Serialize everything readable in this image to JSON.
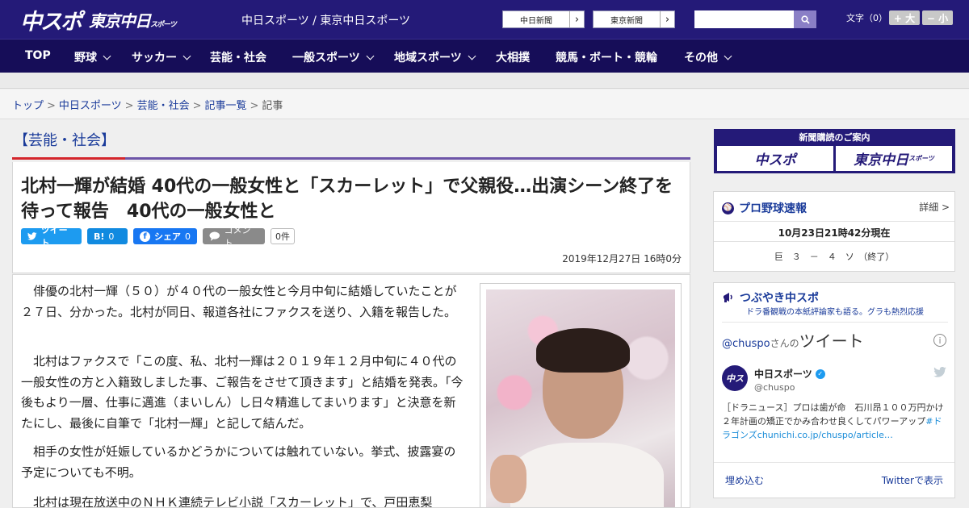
{
  "header": {
    "logo_main": "中スポ",
    "logo_sub": "東京中日",
    "logo_sub_small": "スポーツ",
    "site_title": "中日スポーツ / 東京中日スポーツ",
    "link1": "中日新聞",
    "link2": "東京新聞",
    "font_label": "文字（0）",
    "font_plus": "+ 大",
    "font_minus": "− 小"
  },
  "nav": [
    {
      "label": "TOP",
      "dropdown": false
    },
    {
      "label": "野球",
      "dropdown": true
    },
    {
      "label": "サッカー",
      "dropdown": true
    },
    {
      "label": "芸能・社会",
      "dropdown": false
    },
    {
      "label": "一般スポーツ",
      "dropdown": true
    },
    {
      "label": "地域スポーツ",
      "dropdown": true
    },
    {
      "label": "大相撲",
      "dropdown": false
    },
    {
      "label": "競馬・ボート・競輪",
      "dropdown": false
    },
    {
      "label": "その他",
      "dropdown": true
    }
  ],
  "breadcrumb": {
    "c1": "トップ",
    "c2": "中日スポーツ",
    "c3": "芸能・社会",
    "c4": "記事一覧",
    "c5": "記事",
    "sep": ">"
  },
  "category": "【芸能・社会】",
  "article": {
    "headline": "北村一輝が結婚 40代の一般女性と「スカーレット」で父親役…出演シーン終了を待って報告　40代の一般女性と",
    "tweet": "ツイート",
    "hatena": "B!",
    "hatena_count": "0",
    "share": "シェア",
    "share_count": "0",
    "comment": "コメント",
    "comment_count": "0件",
    "date": "2019年12月27日 16時0分",
    "paragraphs": [
      "俳優の北村一輝（５０）が４０代の一般女性と今月中旬に結婚していたことが２７日、分かった。北村が同日、報道各社にファクスを送り、入籍を報告した。",
      "北村はファクスで「この度、私、北村一輝は２０１９年１２月中旬に４０代の一般女性の方と入籍致しました事、ご報告をさせて頂きます」と結婚を発表。「今後もより一層、仕事に邁進（まいしん）し日々精進してまいります」と決意を新たにし、最後に自筆で「北村一輝」と記して結んだ。",
      "相手の女性が妊娠しているかどうかについては触れていない。挙式、披露宴の予定についても不明。",
      "北村は現在放送中のＮＨＫ連続テレビ小説「スカーレット」で、戸田恵梨"
    ]
  },
  "sidebar": {
    "subscribe_title": "新聞購読のご案内",
    "sub_btn1": "中スポ",
    "sub_btn2": "東京中日",
    "sub_btn2_small": "スポーツ",
    "baseball_title": "プロ野球速報",
    "baseball_more": "詳細 >",
    "baseball_time": "10月23日21時42分現在",
    "baseball_score": "巨　３　－　４　ソ　（終了）",
    "tsubuyaki_title": "つぶやき中スポ",
    "tsubuyaki_sub": "ドラ番観戦の本紙評論家も語る。グラも熱烈応援",
    "tweets_handle": "@chuspo",
    "tweets_san": "さんの",
    "tweets_word": "ツイート",
    "tw_name": "中日スポーツ",
    "tw_handle": "@chuspo",
    "tw_text": "［ドラニュース］プロは歯が命　石川昂１００万円かけ２年計画の矯正でかみ合わせ良くしてパワーアップ",
    "tw_link": "#ドラゴンズchunichi.co.jp/chuspo/article…",
    "embed": "埋め込む",
    "view_on_twitter": "Twitterで表示"
  },
  "colors": {
    "header": "#241a78",
    "nav": "#160d58",
    "accent_red": "#d4262c",
    "accent_purple": "#6d55a8",
    "link": "#1a3b9a"
  }
}
